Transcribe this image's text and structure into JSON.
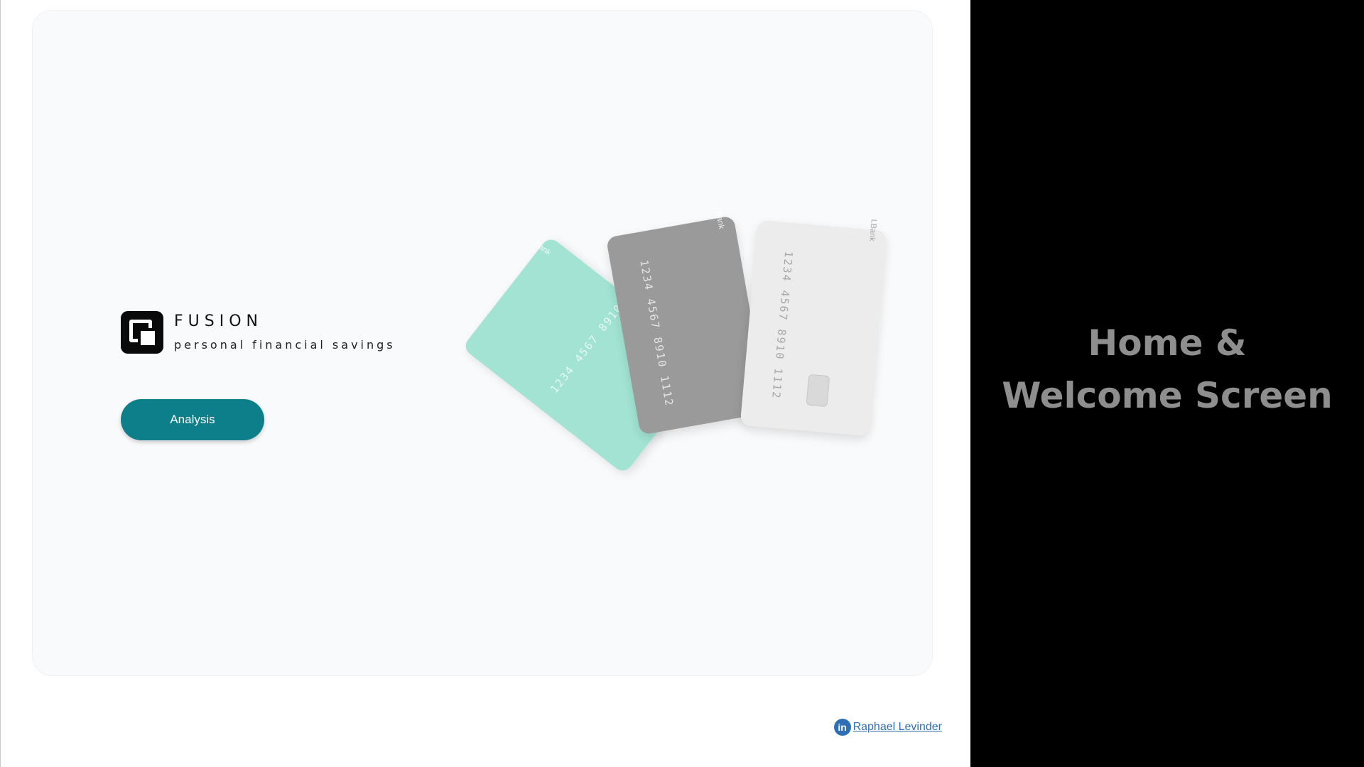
{
  "brand": {
    "name": "FUSION",
    "tagline": "personal financial savings"
  },
  "actions": {
    "analysis_label": "Analysis"
  },
  "cards": {
    "mint_number": "1234 4567 8910 1112",
    "grey_number": "1234 4567 8910 1112",
    "white_number": "1234 4567 8910 1112",
    "logo_text": "LBank"
  },
  "footer": {
    "linkedin_label": "in",
    "author_name": "Raphael Levinder"
  },
  "side_panel": {
    "title_line1": "Home &",
    "title_line2": "Welcome Screen"
  },
  "colors": {
    "accent": "#0c7f8a",
    "mint_card": "#a2e3d3",
    "grey_card": "#9a9a9a",
    "white_card": "#ececec",
    "link": "#2f6fb3"
  }
}
